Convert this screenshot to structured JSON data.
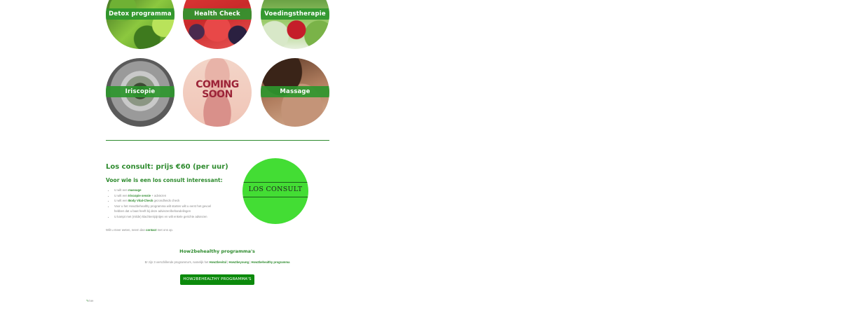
{
  "programs": [
    {
      "label": "Detox programma",
      "image": "limes-cucumber-photo"
    },
    {
      "label": "Health Check",
      "image": "watermelon-berries-photo"
    },
    {
      "label": "Voedingstherapie",
      "image": "vegetables-heart-photo"
    },
    {
      "label": "Iriscopie",
      "image": "eye-iris-photo"
    },
    {
      "label": "COMING SOON",
      "image": "coming-soon-intestines-illustration"
    },
    {
      "label": "Massage",
      "image": "back-massage-photo"
    }
  ],
  "consult": {
    "title": "Los consult: prijs €60 (per uur)",
    "subtitle": "Voor wie is een los consult interessant:",
    "items": [
      {
        "pre": "U wilt een ",
        "bold": "massage",
        "post": ""
      },
      {
        "pre": "U wilt een ",
        "bold": "Iriscopie sessie",
        "post": " + adviezen"
      },
      {
        "pre": "U wilt een ",
        "bold": "Body Vital-Check",
        "post": " gezondheids check"
      },
      {
        "pre": "Voor u het How2behealthy programma wilt starten wilt u eerst het gevoel hebben dat u baat heeft bij deze adviezen/behandelingen",
        "bold": "",
        "post": ""
      },
      {
        "pre": "U kampt met (milde) klachten/pijntjes en wilt enkele gerichte adviezen",
        "bold": "",
        "post": ""
      }
    ],
    "note_pre": "Wilt u meer weten, neem dan ",
    "note_link": "contact",
    "note_post": " met ons op.",
    "badge_text": "LOS CONSULT",
    "badge_color": "#43dd34"
  },
  "programs_section": {
    "title": "How2behealthy programma's",
    "subtitle_pre": "Er zijn 3 verschillende programma's, namelijk het ",
    "link1": "How2bevital",
    "sep1": " | ",
    "link2": "How2beyoung",
    "sep2": " | ",
    "link3": "How2behealthy programma",
    "button_label": "HOW2BEHEALTHY PROGRAMMA'S"
  },
  "edit_link": "Edit",
  "colors": {
    "accent": "#2e8b2e",
    "button": "#0c8a0c"
  }
}
